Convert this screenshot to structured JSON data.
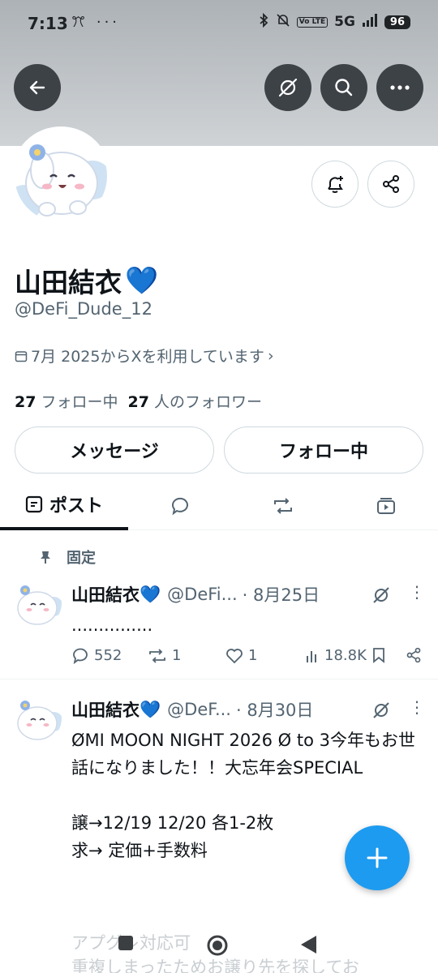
{
  "status_bar": {
    "time": "7:13",
    "left_icons": "ꔫ ···",
    "volte": "Vo LTE",
    "network": "5G",
    "battery": "96"
  },
  "header": {
    "back_icon": "arrow-left-icon",
    "grok_icon": "grok-icon",
    "search_icon": "search-icon",
    "more_icon": "more-horizontal-icon"
  },
  "profile": {
    "display_name": "山田結衣",
    "heart": "💙",
    "handle": "@DeFi_Dude_12",
    "joined": "7月 2025からXを利用しています",
    "following_count": "27",
    "following_label": "フォロー中",
    "followers_count": "27",
    "followers_label": "人のフォロワー",
    "message_button": "メッセージ",
    "following_button": "フォロー中"
  },
  "tabs": {
    "posts": "ポスト"
  },
  "pinned_label": "固定",
  "posts": [
    {
      "name": "山田結衣",
      "handle": "@DeFi...",
      "date": "· 8月25日",
      "body": "...............",
      "replies": "552",
      "reposts": "1",
      "likes": "1",
      "views": "18.8K"
    },
    {
      "name": "山田結衣",
      "handle": "@DeF...",
      "date": "· 8月30日",
      "body": "ØMI MOON NIGHT 2026 Ø to 3今年もお世話になりました！！大忘年会SPECIAL\n\n譲→12/19 12/20 各1-2枚\n求→ 定価+手数料",
      "faded": "アプグレ対応可\n重複しまったためお譲り先を探してお"
    }
  ],
  "colors": {
    "accent": "#1d9bf0",
    "secondary_text": "#536471",
    "border": "#cfd9de"
  }
}
